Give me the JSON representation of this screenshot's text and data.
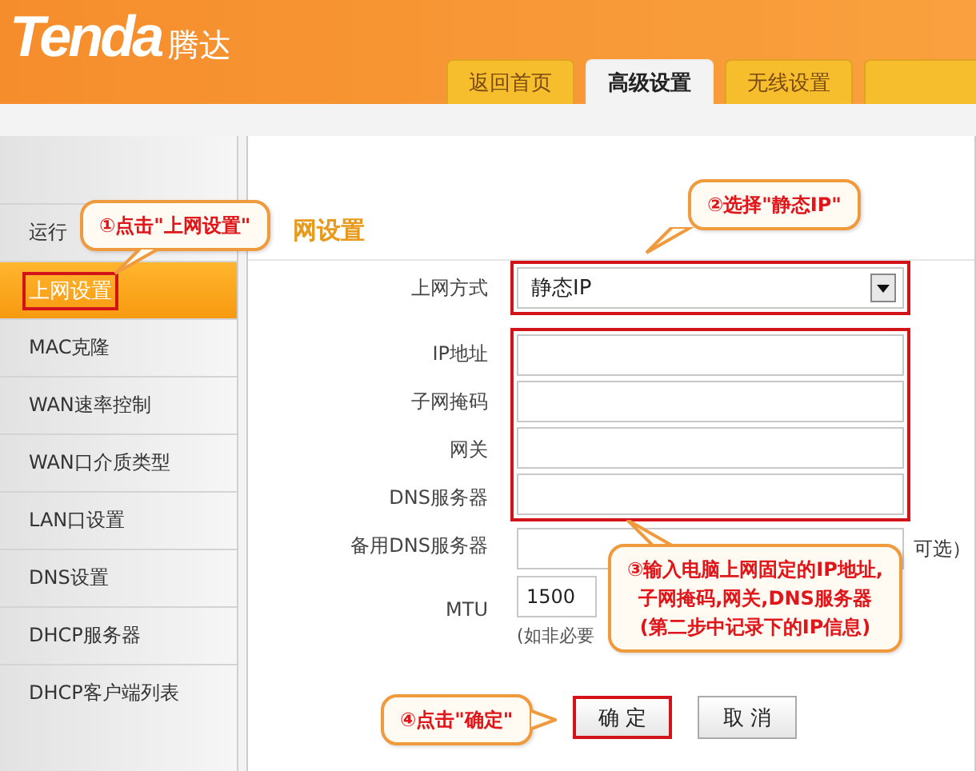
{
  "header": {
    "logo": "Tenda",
    "logo_cn": "腾达",
    "tabs": [
      {
        "label": "返回首页",
        "selected": false
      },
      {
        "label": "高级设置",
        "selected": true
      },
      {
        "label": "无线设置",
        "selected": false
      },
      {
        "selected": false
      }
    ]
  },
  "sidebar": {
    "items": [
      {
        "label": "运行",
        "selected": false,
        "highlighted": false
      },
      {
        "label": "上网设置",
        "selected": true,
        "highlighted": true
      },
      {
        "label": "MAC克隆",
        "selected": false,
        "highlighted": false
      },
      {
        "label": "WAN速率控制",
        "selected": false,
        "highlighted": false
      },
      {
        "label": "WAN口介质类型",
        "selected": false,
        "highlighted": false
      },
      {
        "label": "LAN口设置",
        "selected": false,
        "highlighted": false
      },
      {
        "label": "DNS设置",
        "selected": false,
        "highlighted": false
      },
      {
        "label": "DHCP服务器",
        "selected": false,
        "highlighted": false
      },
      {
        "label": "DHCP客户端列表",
        "selected": false,
        "highlighted": false
      }
    ]
  },
  "page_title": "网设置",
  "form": {
    "mode": {
      "label": "上网方式",
      "value": "静态IP",
      "highlighted": true
    },
    "address_fields": {
      "highlighted": true,
      "items": [
        {
          "label": "IP地址"
        },
        {
          "label": "子网掩码"
        },
        {
          "label": "网关"
        },
        {
          "label": "DNS服务器"
        }
      ]
    },
    "other_fields": [
      {
        "label": "备用DNS服务器",
        "note": "可选）"
      },
      {
        "label": "MTU",
        "value": "1500",
        "hint": "(如非必要"
      }
    ]
  },
  "buttons": [
    {
      "label": "确 定",
      "highlighted": true
    },
    {
      "label": "取 消",
      "highlighted": false
    }
  ],
  "callouts": [
    {
      "lines": [
        "①点击\"上网设置\""
      ]
    },
    {
      "lines": [
        "②选择\"静态IP\""
      ]
    },
    {
      "lines": [
        "③输入电脑上网固定的IP地址,",
        "子网掩码,网关,DNS服务器",
        "(第二步中记录下的IP信息)"
      ]
    },
    {
      "lines": [
        "④点击\"确定\""
      ]
    }
  ]
}
